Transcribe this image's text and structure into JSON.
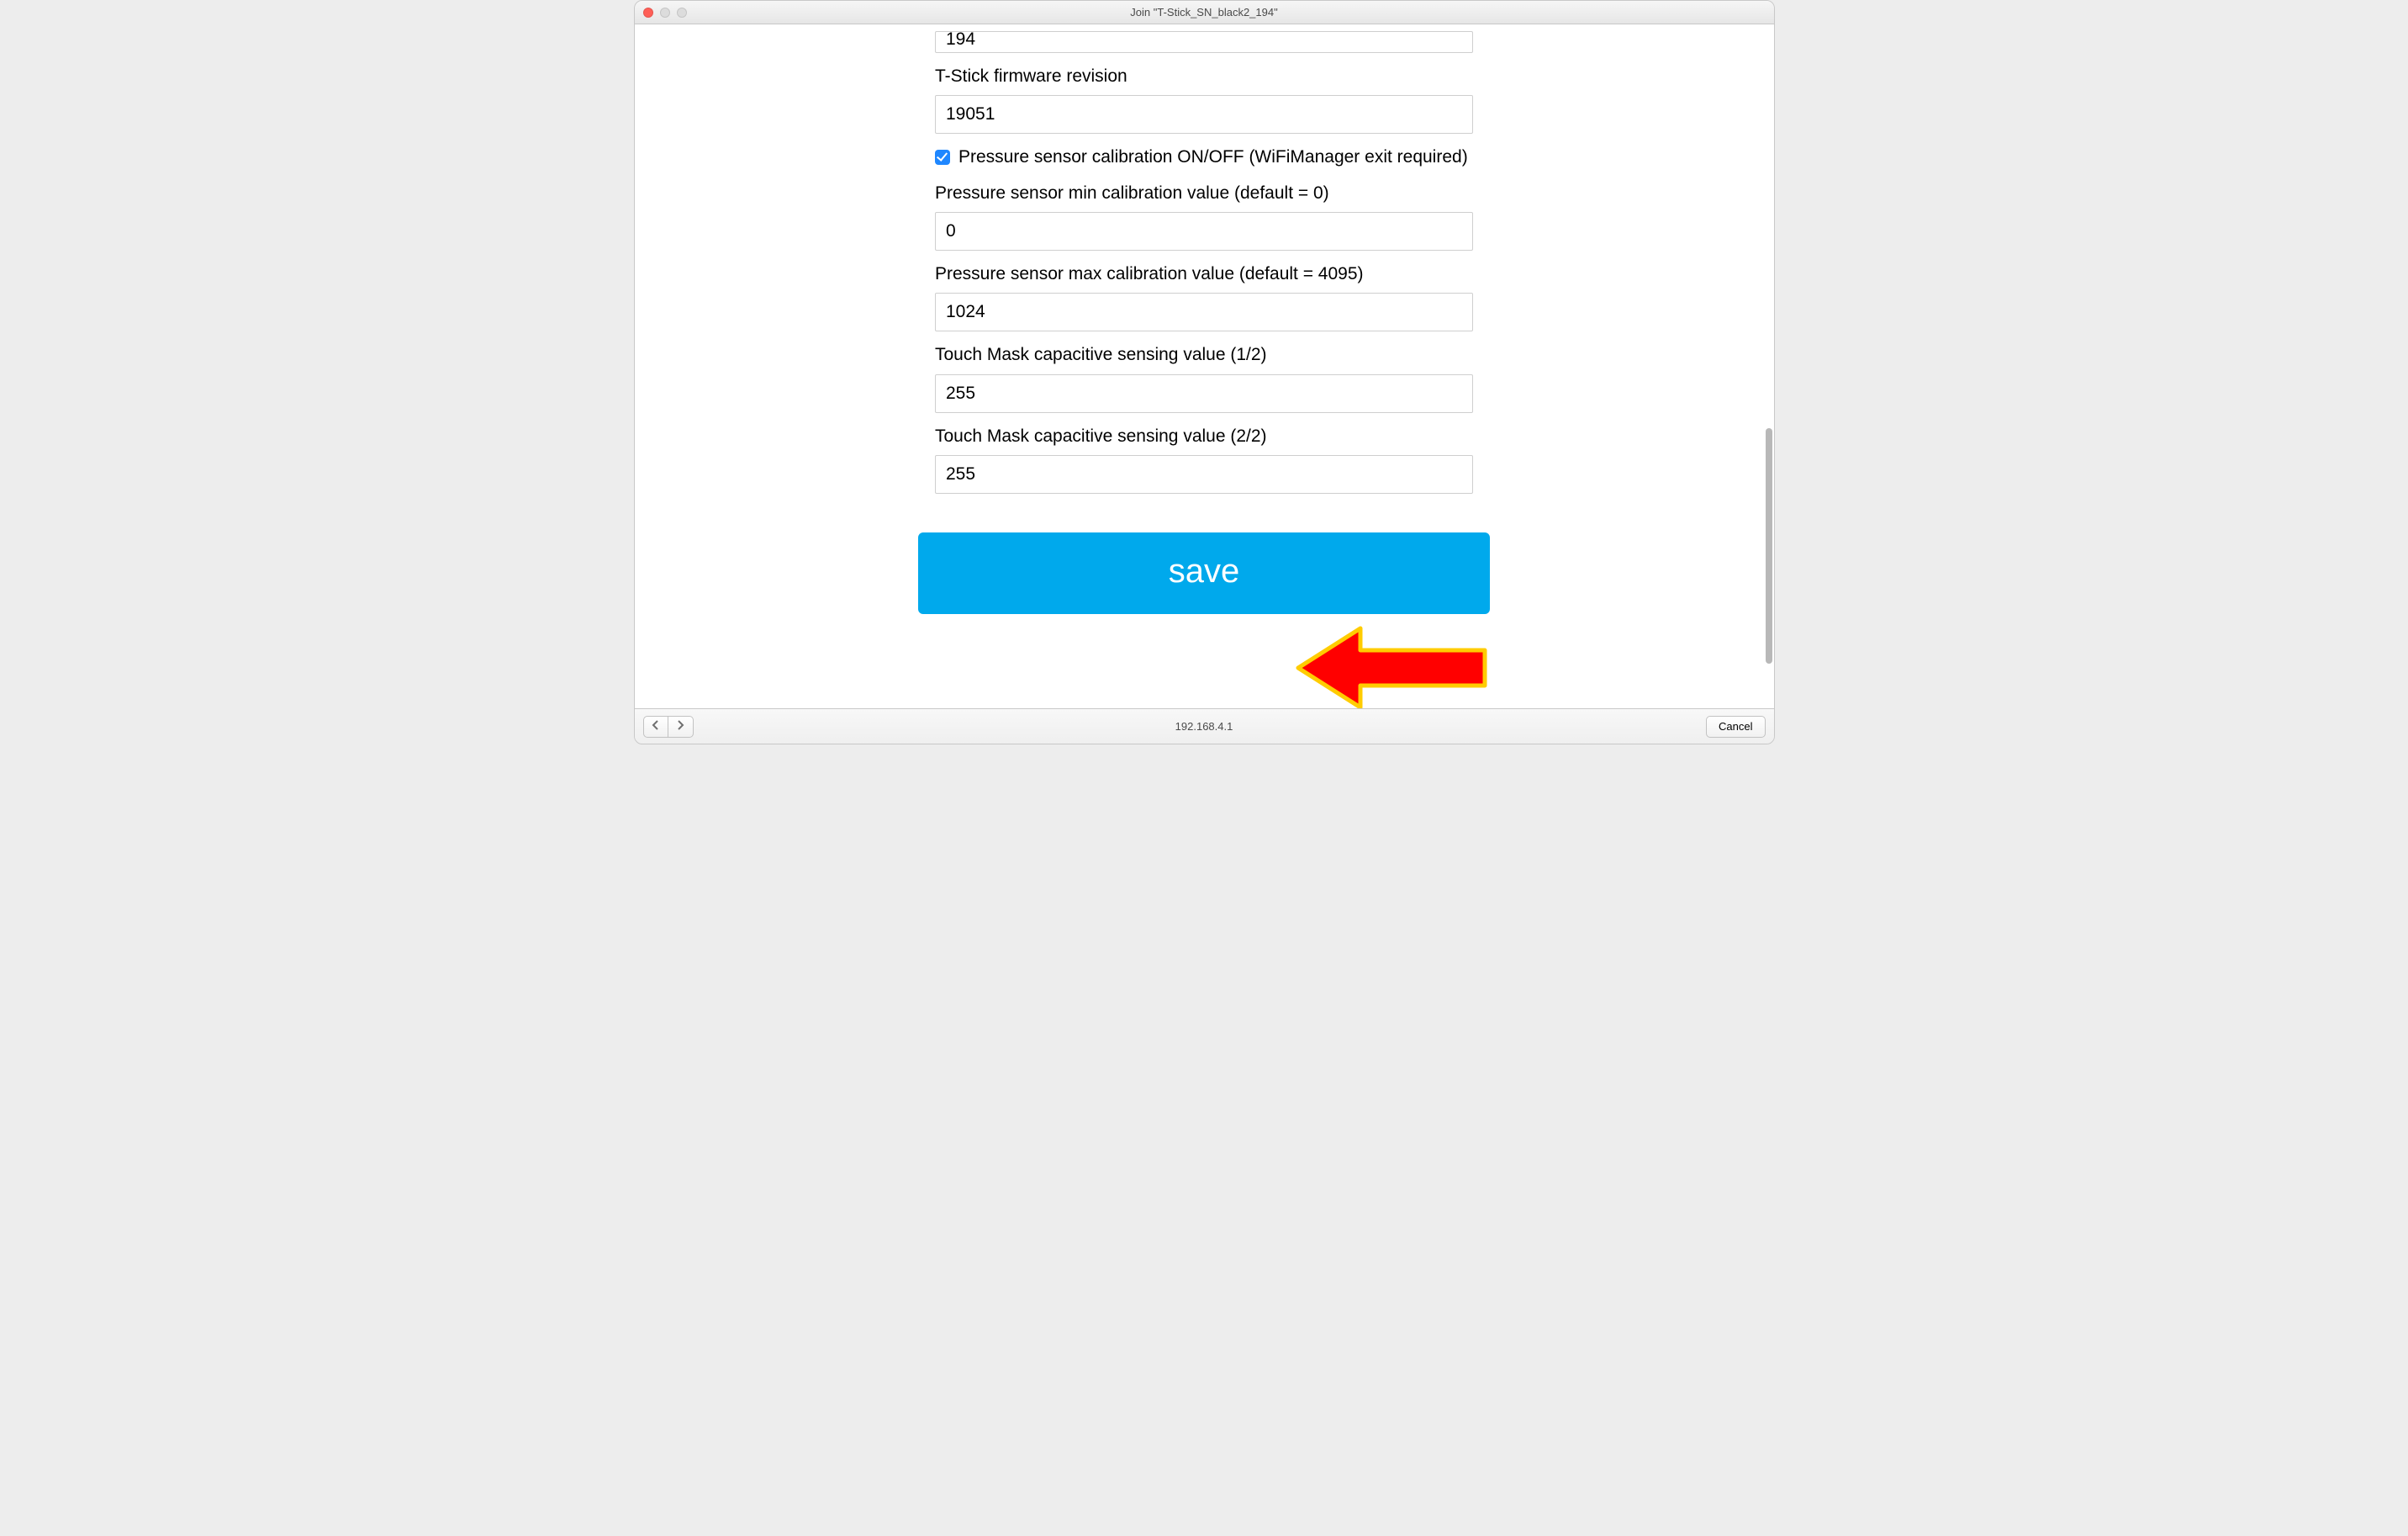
{
  "window": {
    "title": "Join \"T-Stick_SN_black2_194\""
  },
  "form": {
    "clipped_value": "194",
    "firmware_label": "T-Stick firmware revision",
    "firmware_value": "19051",
    "calib_toggle_label": "Pressure sensor calibration ON/OFF (WiFiManager exit required)",
    "min_label": "Pressure sensor min calibration value (default = 0)",
    "min_value": "0",
    "max_label": "Pressure sensor max calibration value (default = 4095)",
    "max_value": "1024",
    "touch1_label": "Touch Mask capacitive sensing value (1/2)",
    "touch1_value": "255",
    "touch2_label": "Touch Mask capacitive sensing value (2/2)",
    "touch2_value": "255",
    "save_label": "save"
  },
  "footer": {
    "address": "192.168.4.1",
    "cancel_label": "Cancel"
  },
  "colors": {
    "accent": "#00a9ec",
    "checkbox": "#1f87ff",
    "arrow_fill": "#ff0000",
    "arrow_stroke": "#ffcc00"
  }
}
